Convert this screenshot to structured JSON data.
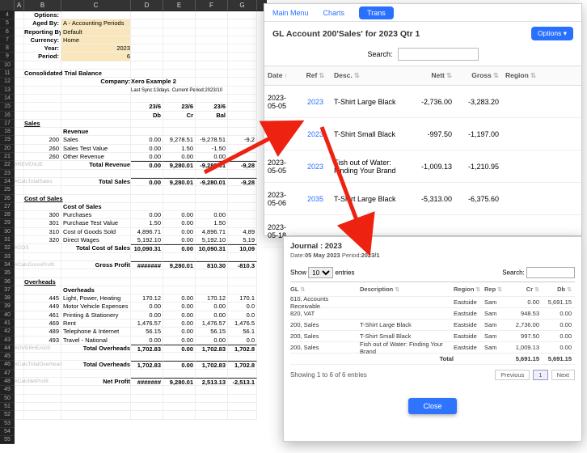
{
  "spreadsheet": {
    "columns": [
      "A",
      "B",
      "C",
      "D",
      "E",
      "F",
      "G"
    ],
    "row_start": 4,
    "row_end": 55,
    "options_label": "Options:",
    "options": {
      "aged_by_label": "Aged By:",
      "aged_by_value": "A - Accounting Periods",
      "reporting_by_label": "Reporting By:",
      "reporting_by_value": "Default",
      "currency_label": "Currency:",
      "currency_value": "Home",
      "year_label": "Year:",
      "year_value": "2023",
      "period_label": "Period:",
      "period_value": "6"
    },
    "report_title": "Consolidated Trial Balance",
    "company_label": "Company:",
    "company_value": "Xero Example 2",
    "sync_line": "Last Sync:13days. Current Period:2023/10",
    "col_headers_period": [
      "23/6",
      "23/6",
      "23/6"
    ],
    "col_headers_type": [
      "Db",
      "Cr",
      "Bal"
    ],
    "sections": {
      "sales": {
        "header": "Sales",
        "sub": "Revenue",
        "lines": [
          {
            "code": "200",
            "name": "Sales",
            "db": "0.00",
            "cr": "9,278.51",
            "bal": "-9,278.51",
            "g": "-9,2"
          },
          {
            "code": "260",
            "name": "Sales Test Value",
            "db": "0.00",
            "cr": "1.50",
            "bal": "-1.50",
            "g": ""
          },
          {
            "code": "260",
            "name": "Other Revenue",
            "db": "0.00",
            "cr": "0.00",
            "bal": "0.00",
            "g": ""
          }
        ],
        "rev_tag": "#REVENUE",
        "total_rev_label": "Total Revenue",
        "total_rev": {
          "db": "0.00",
          "cr": "9,280.01",
          "bal": "-9,280.01",
          "g": "-9,28"
        },
        "calc_tag": "#CalcTotalSales",
        "total_sales_label": "Total Sales",
        "total_sales": {
          "db": "0.00",
          "cr": "9,280.01",
          "bal": "-9,280.01",
          "g": "-9,28"
        }
      },
      "cos": {
        "header": "Cost of Sales",
        "sub": "Cost of Sales",
        "lines": [
          {
            "code": "300",
            "name": "Purchases",
            "db": "0.00",
            "cr": "0.00",
            "bal": "0.00",
            "g": ""
          },
          {
            "code": "301",
            "name": "Purchase Test Value",
            "db": "1.50",
            "cr": "0.00",
            "bal": "1.50",
            "g": ""
          },
          {
            "code": "310",
            "name": "Cost of Goods Sold",
            "db": "4,896.71",
            "cr": "0.00",
            "bal": "4,896.71",
            "g": "4,89"
          },
          {
            "code": "320",
            "name": "Direct Wages",
            "db": "5,192.10",
            "cr": "0.00",
            "bal": "5,192.10",
            "g": "5,19"
          }
        ],
        "cos_tag": "#COS",
        "total_cos_label": "Total Cost of Sales",
        "total_cos": {
          "db": "10,090.31",
          "cr": "0.00",
          "bal": "10,090.31",
          "g": "10,09"
        },
        "gp_tag": "#CalcGrossProfit",
        "gp_label": "Gross Profit",
        "gp": {
          "db": "#######",
          "cr": "9,280.01",
          "bal": "810.30",
          "g": "-810.3"
        }
      },
      "oh": {
        "header": "Overheads",
        "sub": "Overheads",
        "lines": [
          {
            "code": "445",
            "name": "Light, Power, Heating",
            "db": "170.12",
            "cr": "0.00",
            "bal": "170.12",
            "g": "170.1"
          },
          {
            "code": "449",
            "name": "Motor Vehicle Expenses",
            "db": "0.00",
            "cr": "0.00",
            "bal": "0.00",
            "g": "0.0"
          },
          {
            "code": "461",
            "name": "Printing & Stationery",
            "db": "0.00",
            "cr": "0.00",
            "bal": "0.00",
            "g": "0.0"
          },
          {
            "code": "469",
            "name": "Rent",
            "db": "1,476.57",
            "cr": "0.00",
            "bal": "1,476.57",
            "g": "1,476.5"
          },
          {
            "code": "489",
            "name": "Telephone & Internet",
            "db": "56.15",
            "cr": "0.00",
            "bal": "56.15",
            "g": "56.1"
          },
          {
            "code": "493",
            "name": "Travel - National",
            "db": "0.00",
            "cr": "0.00",
            "bal": "0.00",
            "g": "0.0"
          }
        ],
        "oh_tag": "#OVERHEADS",
        "total_oh_label": "Total Overheads",
        "total_oh": {
          "db": "1,702.83",
          "cr": "0.00",
          "bal": "1,702.83",
          "g": "1,702.8"
        },
        "calc_tag": "#CalcTotalOverhead",
        "total_ovh_label": "Total Overheads",
        "total_ovh": {
          "db": "1,702.83",
          "cr": "0.00",
          "bal": "1,702.83",
          "g": "1,702.8"
        },
        "np_tag": "#CalcNetProfit",
        "np_label": "Net Profit",
        "np": {
          "db": "#######",
          "cr": "9,280.01",
          "bal": "2,513.13",
          "g": "-2,513.1"
        }
      }
    }
  },
  "trans": {
    "nav": {
      "main": "Main Menu",
      "charts": "Charts",
      "trans": "Trans"
    },
    "title": "GL Account 200'Sales' for 2023 Qtr 1",
    "options_btn": "Options",
    "search_label": "Search:",
    "search_placeholder": "",
    "columns": [
      "Date",
      "Ref",
      "Desc.",
      "Nett",
      "Gross",
      "Region"
    ],
    "rows": [
      {
        "date": "2023-05-05",
        "ref": "2023",
        "desc": "T-Shirt Large Black",
        "nett": "-2,736.00",
        "gross": "-3,283.20",
        "region": ""
      },
      {
        "date": "2023-05-05",
        "ref": "2023",
        "desc": "T-Shirt Small Black",
        "nett": "-997.50",
        "gross": "-1,197.00",
        "region": ""
      },
      {
        "date": "2023-05-05",
        "ref": "2023",
        "desc": "Fish out of Water: Finding Your Brand",
        "nett": "-1,009.13",
        "gross": "-1,210.95",
        "region": ""
      },
      {
        "date": "2023-05-06",
        "ref": "2035",
        "desc": "T-Shirt Large Black",
        "nett": "-5,313.00",
        "gross": "-6,375.60",
        "region": ""
      },
      {
        "date": "2023-05-18",
        "ref": "",
        "desc": "",
        "nett": "",
        "gross": "",
        "region": ""
      }
    ]
  },
  "journal": {
    "title": "Journal : 2023",
    "date_label": "Date:",
    "date_value": "05 May 2023",
    "period_label": "Period:",
    "period_value": "2023/1",
    "show_label_1": "Show",
    "show_value": "10",
    "show_label_2": "entries",
    "search_label": "Search:",
    "columns": [
      "GL",
      "Description",
      "Region",
      "Rep",
      "Cr",
      "Db"
    ],
    "rows": [
      {
        "gl": "610, Accounts Receivable",
        "desc": "",
        "region": "Eastside",
        "rep": "Sam",
        "cr": "0.00",
        "db": "5,691.15"
      },
      {
        "gl": "820, VAT",
        "desc": "",
        "region": "Eastside",
        "rep": "Sam",
        "cr": "948.53",
        "db": "0.00"
      },
      {
        "gl": "200, Sales",
        "desc": "T-Shirt Large Black",
        "region": "Eastside",
        "rep": "Sam",
        "cr": "2,736.00",
        "db": "0.00"
      },
      {
        "gl": "200, Sales",
        "desc": "T-Shirt Small Black",
        "region": "Eastside",
        "rep": "Sam",
        "cr": "997.50",
        "db": "0.00"
      },
      {
        "gl": "200, Sales",
        "desc": "Fish out of Water: Finding Your Brand",
        "region": "Eastside",
        "rep": "Sam",
        "cr": "1,009.13",
        "db": "0.00"
      }
    ],
    "total_label": "Total",
    "total": {
      "cr": "5,691.15",
      "db": "5,691.15"
    },
    "footer_text": "Showing 1 to 6 of 6 entries",
    "prev": "Previous",
    "page": "1",
    "next": "Next",
    "close": "Close"
  }
}
